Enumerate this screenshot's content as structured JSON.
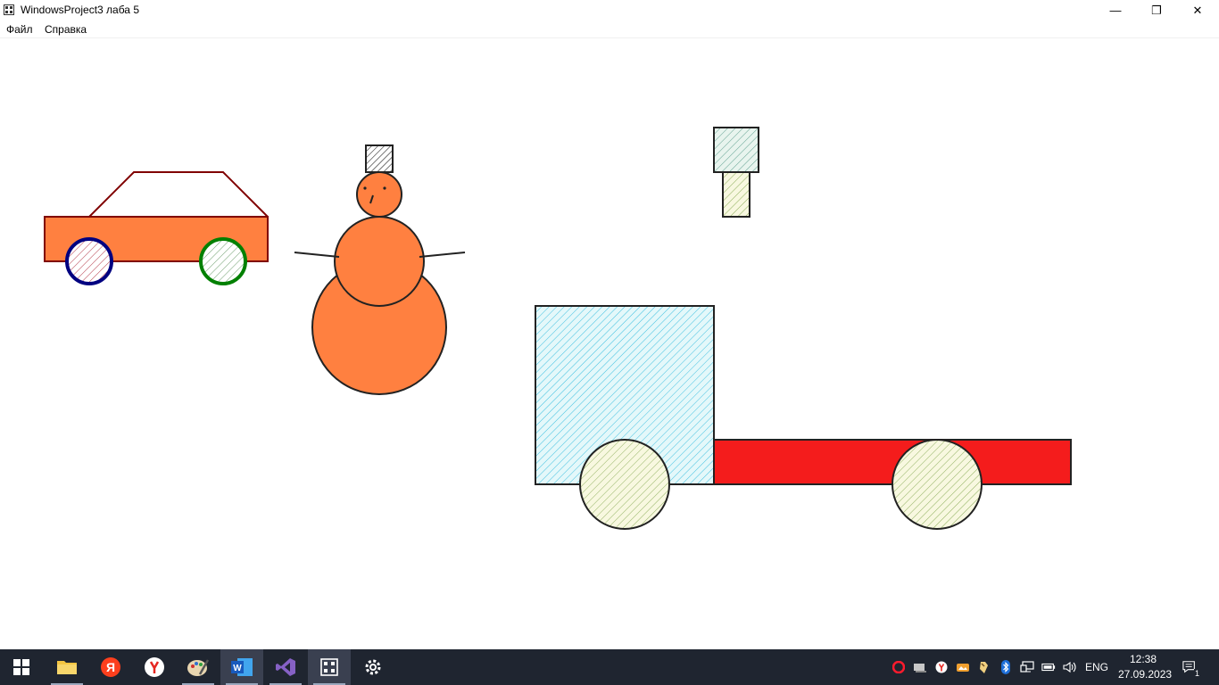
{
  "window": {
    "title": "WindowsProject3 лаба 5",
    "minimize": "—",
    "restore": "❐",
    "close": "✕"
  },
  "menu": {
    "items": [
      {
        "label": "Файл"
      },
      {
        "label": "Справка"
      }
    ]
  },
  "colors": {
    "car_body": "#ff8040",
    "car_outline": "#800000",
    "wheel_blue": "#000080",
    "wheel_green": "#008000",
    "snowman": "#ff8040",
    "truck_cab": "#d8f4f8",
    "truck_bed": "#f41c1c",
    "truck_wheel": "#f8f8e0",
    "hatch_cyan": "#40c0e0",
    "hatch_green": "#90b060"
  },
  "taskbar": {
    "apps": [
      {
        "name": "start-icon"
      },
      {
        "name": "file-explorer-icon"
      },
      {
        "name": "yandex-icon"
      },
      {
        "name": "yandex-browser-icon"
      },
      {
        "name": "paint-icon"
      },
      {
        "name": "word-icon"
      },
      {
        "name": "visual-studio-icon"
      },
      {
        "name": "windows-project-icon"
      },
      {
        "name": "settings-icon"
      }
    ],
    "language": "ENG",
    "time": "12:38",
    "date": "27.09.2023",
    "notifications": "1"
  }
}
